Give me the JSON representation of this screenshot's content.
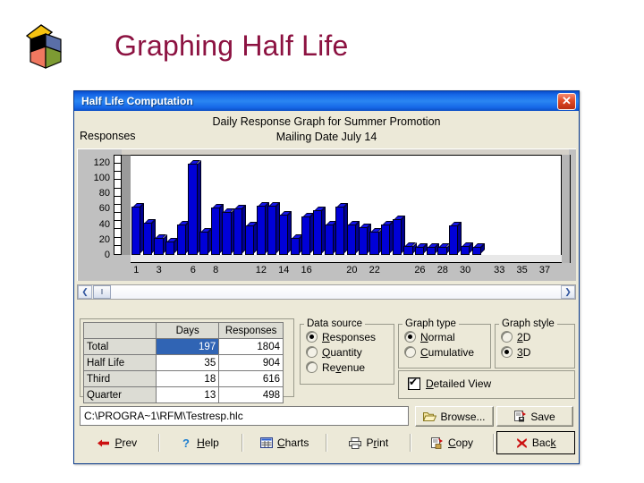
{
  "slide": {
    "title": "Graphing Half Life",
    "title_color": "#8c1241",
    "logo_icon": "open-box-logo"
  },
  "dialog": {
    "title": "Half Life Computation",
    "close_label": "✕"
  },
  "graph": {
    "y_axis_label": "Responses",
    "title_line1": "Daily Response Graph for Summer Promotion",
    "title_line2": "Mailing Date July 14",
    "scroll_left_icon": "❮",
    "scroll_right_icon": "❯",
    "scroll_thumb_icon": "‖"
  },
  "chart_data": {
    "type": "bar",
    "title": "Daily Response Graph for Summer Promotion / Mailing Date July 14",
    "xlabel": "",
    "ylabel": "Responses",
    "ylim": [
      0,
      130
    ],
    "yticks": [
      0,
      20,
      40,
      60,
      80,
      100,
      120
    ],
    "minor_tick_step": 10,
    "grid": false,
    "legend": false,
    "bar_color": "#0000d8",
    "style": "3D",
    "x": [
      1,
      2,
      3,
      4,
      5,
      6,
      7,
      8,
      9,
      10,
      11,
      12,
      13,
      14,
      15,
      16,
      17,
      18,
      19,
      20,
      21,
      22,
      23,
      24,
      25,
      26,
      27,
      28,
      29,
      30,
      31,
      32,
      33,
      34,
      35,
      36,
      37,
      38
    ],
    "xtick_labels": [
      1,
      3,
      6,
      8,
      12,
      14,
      16,
      20,
      22,
      26,
      28,
      30,
      33,
      35,
      37
    ],
    "values": [
      63,
      42,
      22,
      17,
      40,
      118,
      30,
      62,
      56,
      60,
      38,
      64,
      64,
      52,
      22,
      50,
      58,
      40,
      63,
      40,
      36,
      30,
      40,
      46,
      12,
      10,
      10,
      10,
      38,
      12,
      10,
      0,
      0,
      0,
      0,
      0,
      0,
      0
    ],
    "categories": [
      "1",
      "2",
      "3",
      "4",
      "5",
      "6",
      "7",
      "8",
      "9",
      "10",
      "11",
      "12",
      "13",
      "14",
      "15",
      "16",
      "17",
      "18",
      "19",
      "20",
      "21",
      "22",
      "23",
      "24",
      "25",
      "26",
      "27",
      "28",
      "29",
      "30",
      "31",
      "32",
      "33",
      "34",
      "35",
      "36",
      "37",
      "38"
    ]
  },
  "table": {
    "columns": [
      "",
      "Days",
      "Responses"
    ],
    "rows": [
      {
        "label": "Total",
        "days": "197",
        "responses": "1804",
        "selected": true
      },
      {
        "label": "Half Life",
        "days": "35",
        "responses": "904",
        "selected": false
      },
      {
        "label": "Third",
        "days": "18",
        "responses": "616",
        "selected": false
      },
      {
        "label": "Quarter",
        "days": "13",
        "responses": "498",
        "selected": false
      }
    ]
  },
  "data_source": {
    "legend": "Data source",
    "options": [
      {
        "label": "Responses",
        "accel": "R",
        "selected": true
      },
      {
        "label": "Quantity",
        "accel": "Q",
        "selected": false
      },
      {
        "label": "Revenue",
        "accel": "v",
        "selected": false
      }
    ]
  },
  "graph_type": {
    "legend": "Graph type",
    "options": [
      {
        "label": "Normal",
        "accel": "N",
        "selected": true
      },
      {
        "label": "Cumulative",
        "accel": "C",
        "selected": false
      }
    ]
  },
  "graph_style": {
    "legend": "Graph style",
    "options": [
      {
        "label": "2D",
        "accel": "2",
        "selected": false
      },
      {
        "label": "3D",
        "accel": "3",
        "selected": true
      }
    ]
  },
  "detailed_view": {
    "label": "Detailed View",
    "accel": "D",
    "checked": true
  },
  "path": {
    "value": "C:\\PROGRA~1\\RFM\\Testresp.hlc",
    "placeholder": "File path"
  },
  "file_buttons": [
    {
      "label": "Browse...",
      "icon": "folder-open-icon"
    },
    {
      "label": "Save",
      "icon": "save-disk-icon"
    }
  ],
  "toolbar": [
    {
      "label": "Prev",
      "accel": "P",
      "icon": "left-arrow-icon",
      "focused": false
    },
    {
      "label": "Help",
      "accel": "H",
      "icon": "question-mark-icon",
      "focused": false
    },
    {
      "label": "Charts",
      "accel": "C",
      "icon": "grid-chart-icon",
      "focused": false
    },
    {
      "label": "Print",
      "accel": "r",
      "icon": "printer-icon",
      "focused": false
    },
    {
      "label": "Copy",
      "accel": "C",
      "icon": "copy-clipboard-icon",
      "focused": false
    },
    {
      "label": "Back",
      "accel": "k",
      "icon": "red-x-icon",
      "focused": true
    }
  ]
}
